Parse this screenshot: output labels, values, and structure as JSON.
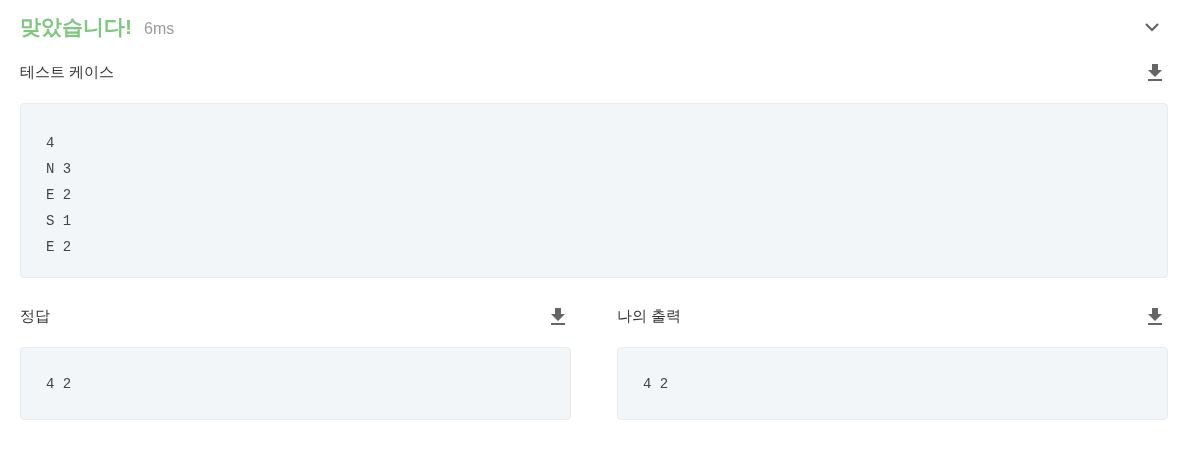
{
  "result": {
    "title": "맞았습니다!",
    "time": "6ms",
    "expanded": true
  },
  "test_case": {
    "label": "테스트 케이스",
    "lines": [
      "4",
      "N 3",
      "E 2",
      "S 1",
      "E 2"
    ]
  },
  "answer": {
    "label": "정답",
    "lines": [
      "4 2"
    ]
  },
  "my_output": {
    "label": "나의 출력",
    "lines": [
      "4 2"
    ]
  }
}
